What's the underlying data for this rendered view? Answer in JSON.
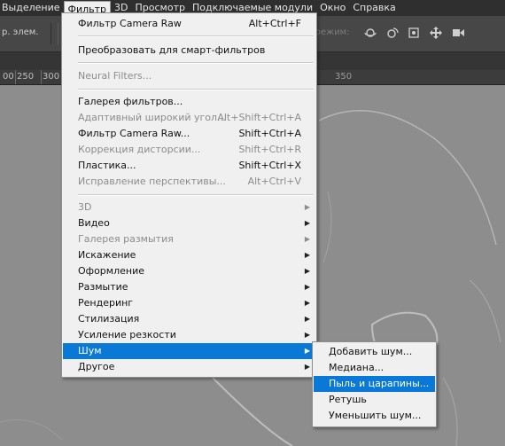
{
  "menubar": {
    "items": [
      "Выделение",
      "Фильтр",
      "3D",
      "Просмотр",
      "Подключаемые модули",
      "Окно",
      "Справка"
    ],
    "active_index": 1
  },
  "options_bar": {
    "left_label": "р. элем.",
    "mode_label": "-режим:",
    "icons": [
      "orbit-3d-icon",
      "roll-3d-icon",
      "pan-3d-icon",
      "slide-3d-icon",
      "scale-3d-icon"
    ]
  },
  "ruler": {
    "ticks": [
      "00",
      "250",
      "300",
      "350"
    ]
  },
  "filter_menu": {
    "items": [
      {
        "label": "Фильтр Camera Raw",
        "shortcut": "Alt+Ctrl+F",
        "disabled": false,
        "submenu": false
      },
      {
        "label": "Преобразовать для смарт-фильтров",
        "shortcut": "",
        "disabled": false,
        "submenu": false
      },
      {
        "label": "Neural Filters...",
        "shortcut": "",
        "disabled": true,
        "submenu": false
      },
      {
        "label": "Галерея фильтров...",
        "shortcut": "",
        "disabled": false,
        "submenu": false
      },
      {
        "label": "Адаптивный широкий угол...",
        "shortcut": "Alt+Shift+Ctrl+A",
        "disabled": true,
        "submenu": false
      },
      {
        "label": "Фильтр Camera Raw...",
        "shortcut": "Shift+Ctrl+A",
        "disabled": false,
        "submenu": false
      },
      {
        "label": "Коррекция дисторсии...",
        "shortcut": "Shift+Ctrl+R",
        "disabled": true,
        "submenu": false
      },
      {
        "label": "Пластика...",
        "shortcut": "Shift+Ctrl+X",
        "disabled": false,
        "submenu": false
      },
      {
        "label": "Исправление перспективы...",
        "shortcut": "Alt+Ctrl+V",
        "disabled": true,
        "submenu": false
      },
      {
        "label": "3D",
        "shortcut": "",
        "disabled": true,
        "submenu": true
      },
      {
        "label": "Видео",
        "shortcut": "",
        "disabled": false,
        "submenu": true
      },
      {
        "label": "Галерея размытия",
        "shortcut": "",
        "disabled": true,
        "submenu": true
      },
      {
        "label": "Искажение",
        "shortcut": "",
        "disabled": false,
        "submenu": true
      },
      {
        "label": "Оформление",
        "shortcut": "",
        "disabled": false,
        "submenu": true
      },
      {
        "label": "Размытие",
        "shortcut": "",
        "disabled": false,
        "submenu": true
      },
      {
        "label": "Рендеринг",
        "shortcut": "",
        "disabled": false,
        "submenu": true
      },
      {
        "label": "Стилизация",
        "shortcut": "",
        "disabled": false,
        "submenu": true
      },
      {
        "label": "Усиление резкости",
        "shortcut": "",
        "disabled": false,
        "submenu": true
      },
      {
        "label": "Шум",
        "shortcut": "",
        "disabled": false,
        "submenu": true,
        "highlighted": true
      },
      {
        "label": "Другое",
        "shortcut": "",
        "disabled": false,
        "submenu": true
      }
    ]
  },
  "noise_submenu": {
    "items": [
      {
        "label": "Добавить шум..."
      },
      {
        "label": "Медиана..."
      },
      {
        "label": "Пыль и царапины...",
        "highlighted": true
      },
      {
        "label": "Ретушь"
      },
      {
        "label": "Уменьшить шум..."
      }
    ]
  }
}
